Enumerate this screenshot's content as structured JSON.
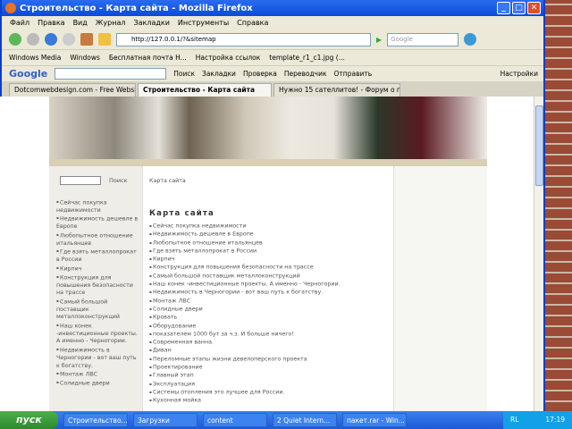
{
  "window": {
    "title": "Строительство - Карта сайта - Mozilla Firefox"
  },
  "menu": [
    "Файл",
    "Правка",
    "Вид",
    "Журнал",
    "Закладки",
    "Инструменты",
    "Справка"
  ],
  "nav": {
    "url": "http://127.0.0.1/?&sitemap",
    "search_placeholder": "Google"
  },
  "bookmarks": [
    "Windows Media",
    "Windows",
    "Бесплатная почта H...",
    "Настройка ссылок",
    "template_r1_c1.jpg (..."
  ],
  "google_bar": {
    "logo": "Google",
    "items": [
      "Поиск",
      "Закладки",
      "Проверка",
      "Переводчик",
      "Отправить",
      "Настройки"
    ]
  },
  "tabs": [
    "Dotcomwebdesign.com - Free Website...",
    "Строительство - Карта сайта",
    "Нужно 15 сателлитов! - Форум о по..."
  ],
  "sidebar": {
    "search_button": "Поиск",
    "items": [
      "Сейчас покупка недвижимости",
      "Недвижимость  дешевле в Европе",
      "Любопытное отношение итальянцев",
      "Где взять металлопрокат в России",
      "Кирпич",
      "Конструкция для повышения безопасности на трассе",
      "Самый большой поставщик металлоконструкций",
      "Наш конек -инвестиционные проекты. А именно - Черногории.",
      "Недвижимость в Черногории - вот ваш путь к богатству.",
      "Монтаж ЛВС",
      "Солидные двери"
    ]
  },
  "main": {
    "breadcrumb": "Карта сайта",
    "heading": "Карта сайта",
    "items": [
      "Сейчас покупка недвижимости",
      "Недвижимость  дешевле в Европе",
      "Любопытное отношение итальянцев",
      "Где взять металлопрокат в России",
      "Кирпич",
      "Конструкция для повышения безопасности на трассе",
      "Самый большой поставщик металлоконструкций",
      "Наш конек -инвестиционные проекты. А именно - Черногории.",
      "Недвижимость в Черногории - вот ваш путь к богатству.",
      "Монтаж ЛВС",
      "Солидные двери",
      "Кровать",
      "Оборудование",
      "показателем 1000 бут за ч.з. И больше ничего!",
      "Современная ванна.",
      "Диван",
      "Переломные этапы жизни девелоперского проекта",
      "Проектирование",
      "Главный этап",
      "Эксплуатация",
      "Системы отопления это лучшее для России.",
      "Кухонная мойка"
    ]
  },
  "taskbar": {
    "start": "пуск",
    "items": [
      "Строительство...",
      "Загрузки",
      "content",
      "2 Quiet Intern...",
      "пакет.rar - Win..."
    ],
    "lang": "RL",
    "clock": "17:19"
  }
}
